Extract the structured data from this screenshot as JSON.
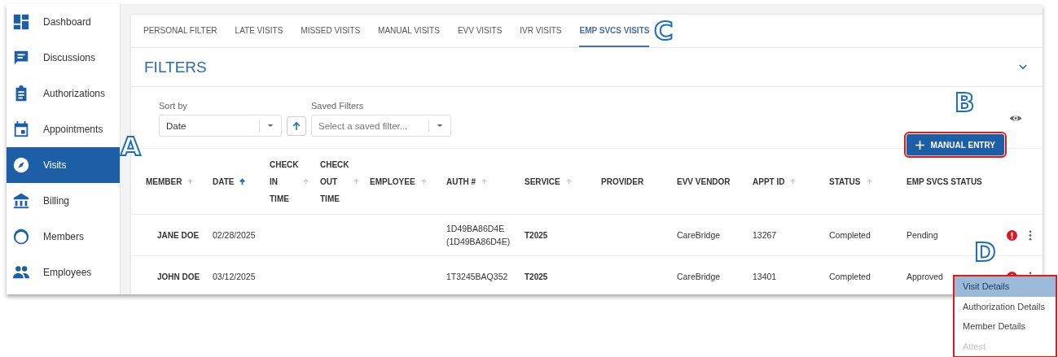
{
  "sidebar": {
    "items": [
      {
        "label": "Dashboard",
        "selected": false
      },
      {
        "label": "Discussions",
        "selected": false
      },
      {
        "label": "Authorizations",
        "selected": false
      },
      {
        "label": "Appointments",
        "selected": false
      },
      {
        "label": "Visits",
        "selected": true
      },
      {
        "label": "Billing",
        "selected": false
      },
      {
        "label": "Members",
        "selected": false
      },
      {
        "label": "Employees",
        "selected": false
      }
    ]
  },
  "tabs": [
    {
      "label": "PERSONAL FILTER",
      "selected": false
    },
    {
      "label": "LATE VISITS",
      "selected": false
    },
    {
      "label": "MISSED VISITS",
      "selected": false
    },
    {
      "label": "MANUAL VISITS",
      "selected": false
    },
    {
      "label": "EVV VISITS",
      "selected": false
    },
    {
      "label": "IVR VISITS",
      "selected": false
    },
    {
      "label": "EMP SVCS VISITS",
      "selected": true
    }
  ],
  "filters": {
    "title": "FILTERS",
    "sort_by": {
      "label": "Sort by",
      "value": "Date"
    },
    "saved_filters": {
      "label": "Saved Filters",
      "placeholder": "Select a saved filter..."
    }
  },
  "manual_entry_button": {
    "label": "MANUAL ENTRY",
    "highlighted": true
  },
  "table": {
    "columns": [
      {
        "label": "MEMBER",
        "sortable": true,
        "sorted": false
      },
      {
        "label": "DATE",
        "sortable": true,
        "sorted": true
      },
      {
        "label": "CHECK IN TIME",
        "sortable": true,
        "sorted": false
      },
      {
        "label": "CHECK OUT TIME",
        "sortable": true,
        "sorted": false
      },
      {
        "label": "EMPLOYEE",
        "sortable": true,
        "sorted": false
      },
      {
        "label": "AUTH #",
        "sortable": true,
        "sorted": false
      },
      {
        "label": "SERVICE",
        "sortable": true,
        "sorted": false
      },
      {
        "label": "PROVIDER",
        "sortable": false,
        "sorted": false
      },
      {
        "label": "EVV VENDOR",
        "sortable": false,
        "sorted": false
      },
      {
        "label": "APPT ID",
        "sortable": true,
        "sorted": false
      },
      {
        "label": "STATUS",
        "sortable": true,
        "sorted": false
      },
      {
        "label": "EMP SVCS STATUS",
        "sortable": false,
        "sorted": false
      }
    ],
    "rows": [
      {
        "cells": [
          "JANE DOE",
          "02/28/2025",
          "",
          "",
          "",
          "1D49BA86D4E (1D49BA86D4E)",
          "T2025",
          "",
          "CareBridge",
          "13267",
          "Completed",
          "Pending"
        ],
        "alert": true
      },
      {
        "cells": [
          "JOHN DOE",
          "03/12/2025",
          "",
          "",
          "",
          "1T3245BAQ352",
          "T2025",
          "",
          "CareBridge",
          "13401",
          "Completed",
          "Approved"
        ],
        "alert": true
      }
    ]
  },
  "row_menu": {
    "highlighted": true,
    "items": [
      {
        "label": "Visit Details",
        "selected": true,
        "disabled": false
      },
      {
        "label": "Authorization Details",
        "selected": false,
        "disabled": false
      },
      {
        "label": "Member Details",
        "selected": false,
        "disabled": false
      },
      {
        "label": "Attest",
        "selected": false,
        "disabled": true
      }
    ]
  },
  "callouts": [
    {
      "label": "A"
    },
    {
      "label": "B"
    },
    {
      "label": "C"
    },
    {
      "label": "D"
    }
  ]
}
